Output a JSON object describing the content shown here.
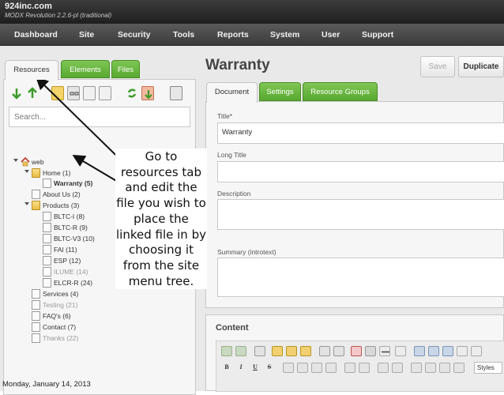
{
  "window": {
    "site_name": "924inc.com",
    "version": "MODX Revolution 2.2.6-pl (traditional)"
  },
  "nav": [
    "Dashboard",
    "Site",
    "Security",
    "Tools",
    "Reports",
    "System",
    "User",
    "Support"
  ],
  "left_tabs": [
    "Resources",
    "Elements",
    "Files"
  ],
  "search": {
    "placeholder": "Search..."
  },
  "tree": [
    {
      "label": "web",
      "icon": "home-icon",
      "muted": false
    },
    {
      "label": "Home (1)",
      "icon": "folder-icon",
      "muted": false
    },
    {
      "label": "Warranty (5)",
      "icon": "document-icon",
      "muted": false,
      "bold": true
    },
    {
      "label": "About Us (2)",
      "icon": "document-icon",
      "muted": false
    },
    {
      "label": "Products (3)",
      "icon": "folder-icon",
      "muted": false
    },
    {
      "label": "BLTC-I (8)",
      "icon": "document-icon",
      "muted": false
    },
    {
      "label": "BLTC-R (9)",
      "icon": "document-icon",
      "muted": false
    },
    {
      "label": "BLTC-V3 (10)",
      "icon": "document-icon",
      "muted": false
    },
    {
      "label": "FAI (11)",
      "icon": "document-icon",
      "muted": false
    },
    {
      "label": "ESP (12)",
      "icon": "document-icon",
      "muted": false
    },
    {
      "label": "ILUME (14)",
      "icon": "document-icon",
      "muted": true
    },
    {
      "label": "ELCR-R (24)",
      "icon": "document-icon",
      "muted": false
    },
    {
      "label": "Services (4)",
      "icon": "document-icon",
      "muted": false
    },
    {
      "label": "Testing (21)",
      "icon": "document-icon",
      "muted": true
    },
    {
      "label": "FAQ's (6)",
      "icon": "document-icon",
      "muted": false
    },
    {
      "label": "Contact (7)",
      "icon": "document-icon",
      "muted": false
    },
    {
      "label": "Thanks (22)",
      "icon": "document-icon",
      "muted": true
    }
  ],
  "resource": {
    "title": "Warranty",
    "buttons": {
      "save": "Save",
      "duplicate": "Duplicate"
    },
    "tabs": [
      "Document",
      "Settings",
      "Resource Groups"
    ],
    "fields": {
      "title_label": "Title*",
      "title_value": "Warranty",
      "long_title_label": "Long Title",
      "description_label": "Description",
      "summary_label": "Summary (introtext)"
    },
    "content_label": "Content",
    "editor_text_buttons": [
      "B",
      "I",
      "U",
      "S"
    ],
    "styles_label": "Styles"
  },
  "callout": "Go to resources tab and edit the file you wish to place the linked file in by choosing it from the site menu tree.",
  "footer_date": "Monday, January 14, 2013",
  "colors": {
    "accent_green": "#6bb843",
    "topbar": "#2e2e2e",
    "annotation_arrow": "#111111"
  }
}
